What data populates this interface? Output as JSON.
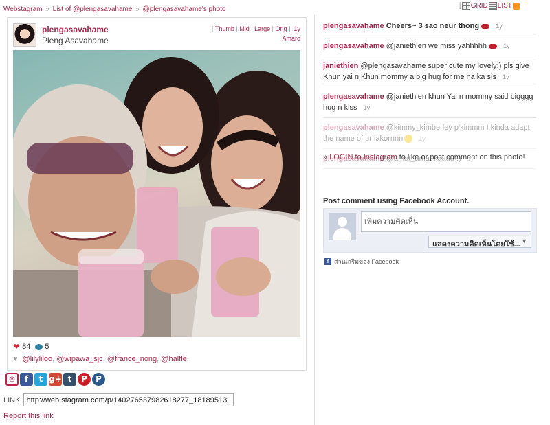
{
  "breadcrumb": {
    "items": [
      "Webstagram",
      "List of @plengasavahame",
      "@plengasavahame's photo"
    ],
    "sep": "»"
  },
  "view_toggle": {
    "grid_label": "GRID",
    "list_label": "LIST",
    "bracket": "["
  },
  "post": {
    "username": "plengasavahame",
    "full_name": "Pleng Asavahame",
    "sizes": [
      "Thumb",
      "Mid",
      "Large",
      "Orig"
    ],
    "age": "1y",
    "filter": "Amaro",
    "likes": "84",
    "comments": "5",
    "likers": [
      "@lilyliloo",
      "@wipawa_sjc",
      "@france_nong",
      "@halfle"
    ]
  },
  "share_icons": [
    "instagram-icon",
    "facebook-icon",
    "twitter-icon",
    "google-plus-icon",
    "tumblr-icon",
    "pinterest-icon",
    "pinterest-alt-icon"
  ],
  "link_row": {
    "label": "LINK",
    "value": "http://web.stagram.com/p/140276537982618277_18189513"
  },
  "report_label": "Report this link",
  "comments": [
    {
      "user": "plengasavahame",
      "text": "Cheers~ 3 sao neur thong",
      "age": "1y",
      "bold": true,
      "faded": false,
      "emoji": "lips"
    },
    {
      "user": "plengasavahame",
      "text": "@janiethien we miss yahhhhh",
      "age": "1y",
      "bold": false,
      "faded": false,
      "emoji": "lips"
    },
    {
      "user": "janiethien",
      "text": "@plengasavahame super cute my lovely:) pls give Khun yai n Khun mommy a big hug for me na ka sis",
      "age": "1y",
      "bold": false,
      "faded": false,
      "emoji": ""
    },
    {
      "user": "plengasavahame",
      "text": "@janiethien khun Yai n mommy said bigggg hug n kiss",
      "age": "1y",
      "bold": false,
      "faded": false,
      "emoji": ""
    },
    {
      "user": "plengasavahame",
      "text": "@kimmy_kimberley p'kimmm I kinda adapt the name of ur lakornnn",
      "age": "1y",
      "bold": false,
      "faded": true,
      "emoji": "smiley"
    },
    {
      "user": "plengasavahame",
      "text": "@amat_amat kaaaa :)",
      "age": "1y",
      "bold": false,
      "faded": true,
      "emoji": ""
    }
  ],
  "login": {
    "prefix": "»",
    "link": "LOGIN to Instagram",
    "rest": "to like or post comment on this photo!"
  },
  "facebook": {
    "title": "Post comment using Facebook Account.",
    "placeholder": "เพิ่มความคิดเห็น",
    "select_label": "แสดงความคิดเห็นโดยใช้...",
    "plugin_label": "ส่วนเสริมของ Facebook"
  },
  "colors": {
    "accent": "#a3294f",
    "facebook": "#3b5998"
  }
}
